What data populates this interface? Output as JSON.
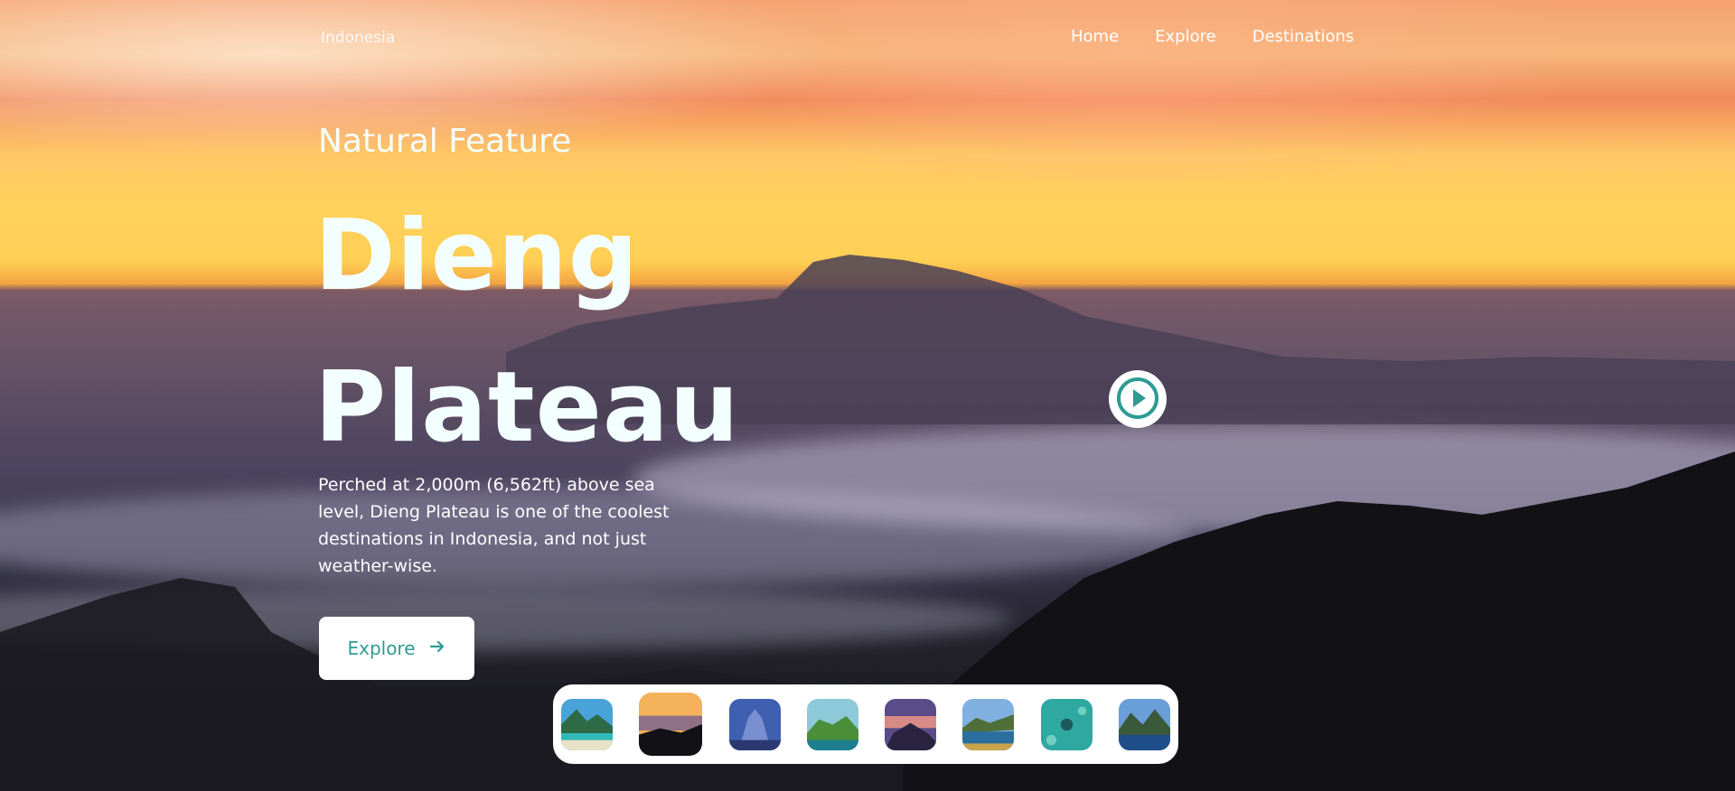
{
  "nav": {
    "brand": "Indonesia",
    "links": [
      "Home",
      "Explore",
      "Destinations"
    ]
  },
  "hero": {
    "eyebrow": "Natural Feature",
    "title_line1": "Dieng",
    "title_line2": "Plateau",
    "description": "Perched at 2,000m (6,562ft) above sea level, Dieng Plateau is one of the coolest destinations in Indonesia, and not just weather-wise.",
    "explore_label": "Explore",
    "explore_icon": "arrow-right-icon",
    "play_icon": "play-circle-icon"
  },
  "thumbnails": {
    "active_index": 1,
    "count": 8
  },
  "colors": {
    "accent": "#2e9b94",
    "text_light": "#f3ffff",
    "panel": "#ffffff"
  }
}
